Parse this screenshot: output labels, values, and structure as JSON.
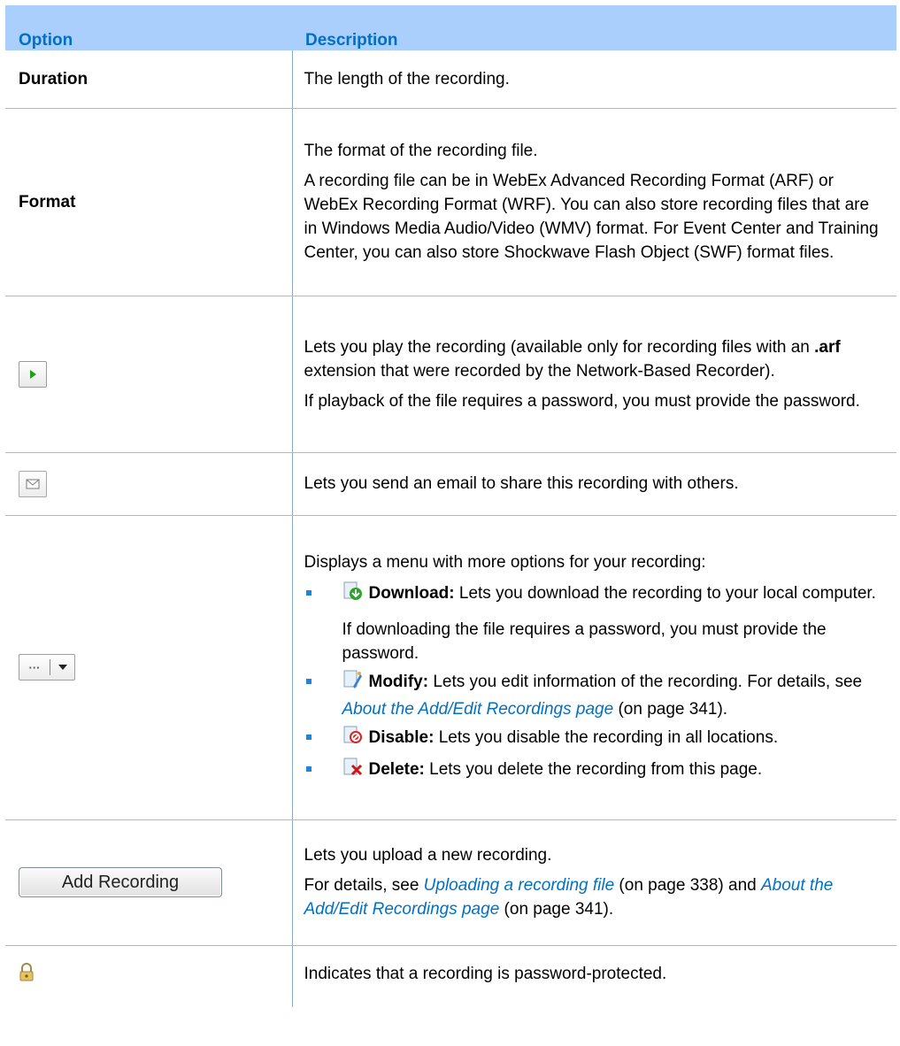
{
  "header": {
    "option": "Option",
    "description": "Description"
  },
  "rows": {
    "duration": {
      "option": "Duration",
      "desc": "The length of the recording."
    },
    "format": {
      "option": "Format",
      "p1": "The format of the recording file.",
      "p2": "A recording file can be in WebEx Advanced Recording Format (ARF) or WebEx Recording Format (WRF). You can also store recording files that are in Windows Media Audio/Video (WMV) format. For Event Center and Training Center, you can also store Shockwave Flash Object (SWF) format files."
    },
    "play": {
      "icon": "play-icon",
      "p1_a": "Lets you play the recording (available only for recording files with an ",
      "p1_b": ".arf",
      "p1_c": " extension that were recorded by the Network-Based Recorder).",
      "p2": "If playback of the file requires a password, you must provide the password."
    },
    "email": {
      "icon": "envelope-icon",
      "desc": "Lets you send an email to share this recording with others."
    },
    "more": {
      "icon": "more-options-icon",
      "intro": "Displays a menu with more options for your recording:",
      "download_label": "Download:",
      "download_text": " Lets you download the recording to your local computer.",
      "download_note": "If downloading the file requires a password, you must provide the password.",
      "modify_label": "Modify:",
      "modify_text": " Lets you edit information of the recording. For details, see ",
      "modify_link": "About the Add/Edit Recordings page",
      "modify_tail": " (on page 341).",
      "disable_label": "Disable:",
      "disable_text": " Lets you disable the recording in all locations.",
      "delete_label": "Delete:",
      "delete_text": " Lets you delete the recording from this page."
    },
    "add": {
      "button_label": "Add Recording",
      "p1": "Lets you upload a new recording.",
      "p2_a": "For details, see ",
      "p2_link1": "Uploading a recording file",
      "p2_b": " (on page 338) and ",
      "p2_link2": "About the Add/Edit Recordings page",
      "p2_c": " (on page 341)."
    },
    "lock": {
      "icon": "lock-icon",
      "desc": "Indicates that a recording is password-protected."
    }
  },
  "colors": {
    "header_bg": "#aacffc",
    "header_text": "#0070c5",
    "link": "#0070c5",
    "bullet": "#1f84d6"
  }
}
